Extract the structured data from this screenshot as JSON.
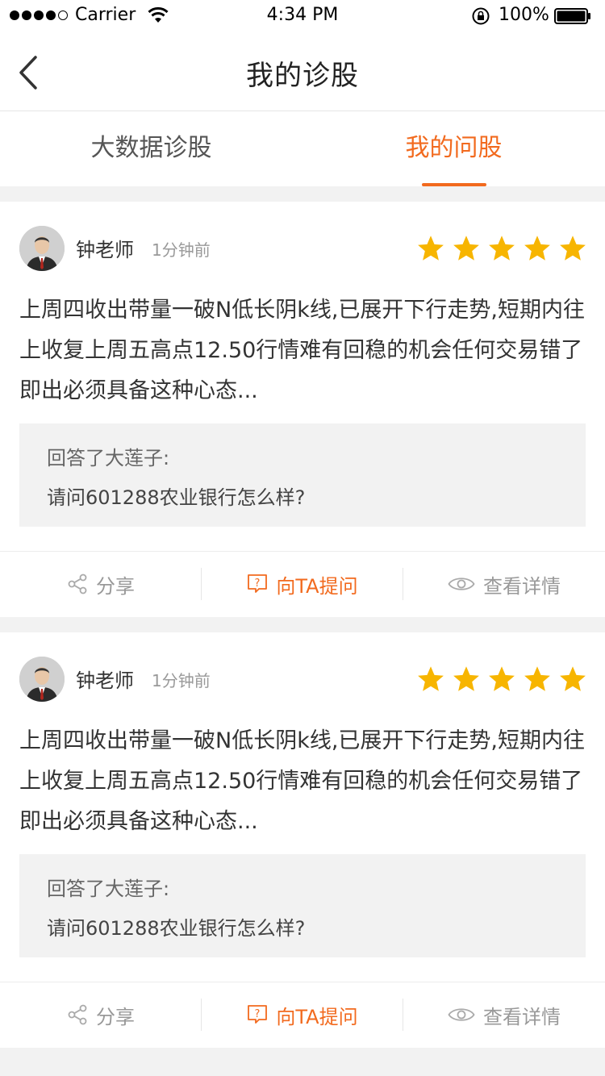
{
  "status_bar": {
    "carrier": "Carrier",
    "time": "4:34 PM",
    "battery": "100%"
  },
  "nav": {
    "title": "我的诊股"
  },
  "tabs": [
    {
      "label": "大数据诊股",
      "active": false
    },
    {
      "label": "我的问股",
      "active": true
    }
  ],
  "colors": {
    "accent": "#f26a1e",
    "star": "#f7b500"
  },
  "cards": [
    {
      "author": "钟老师",
      "time_ago": "1分钟前",
      "rating": 5,
      "content": "上周四收出带量一破N低长阴k线,已展开下行走势,短期内往上收复上周五高点12.50行情难有回稳的机会任何交易错了即出必须具备这种心态...",
      "reply_label": "回答了大莲子:",
      "question": "请问601288农业银行怎么样?",
      "actions": {
        "share": "分享",
        "ask": "向TA提问",
        "detail": "查看详情"
      }
    },
    {
      "author": "钟老师",
      "time_ago": "1分钟前",
      "rating": 5,
      "content": "上周四收出带量一破N低长阴k线,已展开下行走势,短期内往上收复上周五高点12.50行情难有回稳的机会任何交易错了即出必须具备这种心态...",
      "reply_label": "回答了大莲子:",
      "question": "请问601288农业银行怎么样?",
      "actions": {
        "share": "分享",
        "ask": "向TA提问",
        "detail": "查看详情"
      }
    }
  ]
}
